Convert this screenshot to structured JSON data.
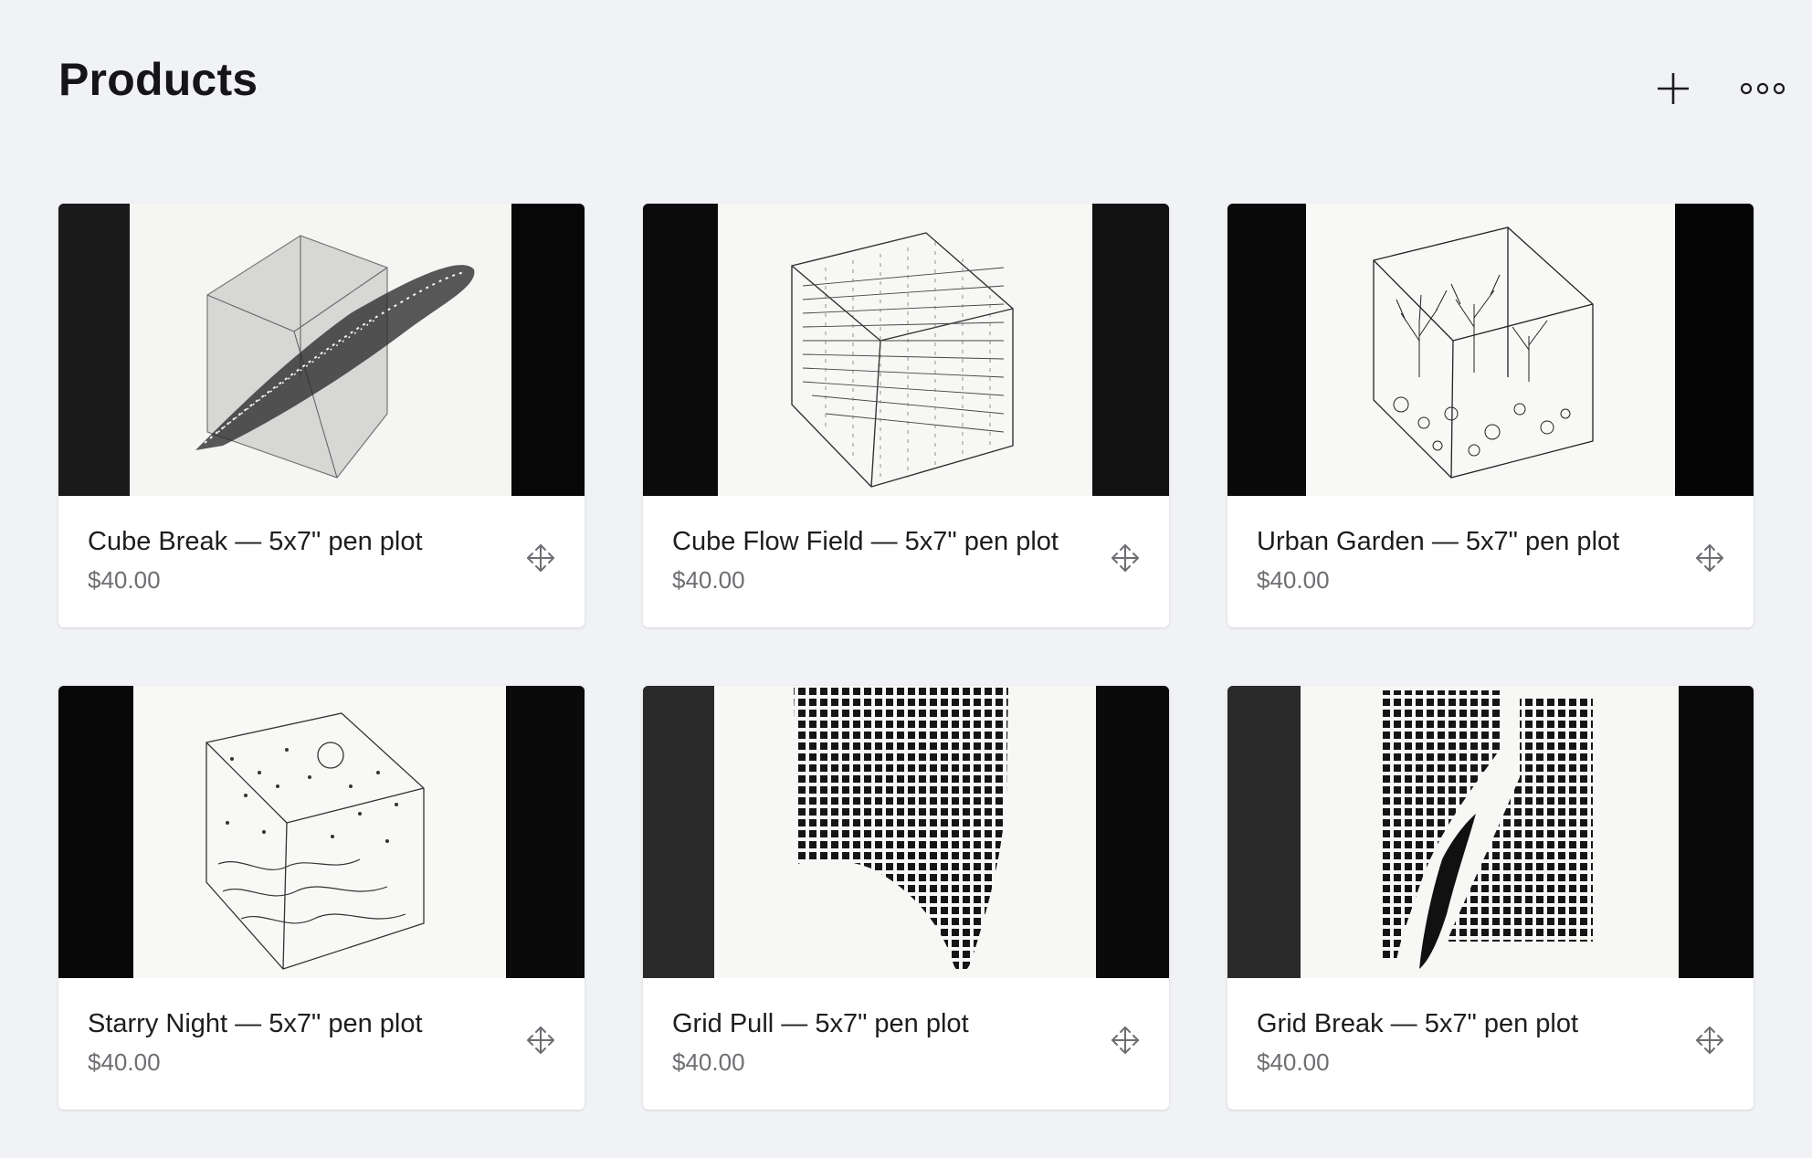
{
  "header": {
    "title": "Products",
    "add_icon": "plus-icon",
    "more_icon": "more-horizontal-icon"
  },
  "products": [
    {
      "title": "Cube Break — 5x7\" pen plot",
      "price": "$40.00",
      "image": "cube-break-artwork"
    },
    {
      "title": "Cube Flow Field — 5x7\" pen plot",
      "price": "$40.00",
      "image": "cube-flow-field-artwork"
    },
    {
      "title": "Urban Garden — 5x7\" pen plot",
      "price": "$40.00",
      "image": "urban-garden-artwork"
    },
    {
      "title": "Starry Night — 5x7\" pen plot",
      "price": "$40.00",
      "image": "starry-night-artwork"
    },
    {
      "title": "Grid Pull — 5x7\" pen plot",
      "price": "$40.00",
      "image": "grid-pull-artwork"
    },
    {
      "title": "Grid Break — 5x7\" pen plot",
      "price": "$40.00",
      "image": "grid-break-artwork"
    }
  ],
  "colors": {
    "background": "#f1f2f5",
    "card": "#ffffff",
    "text": "#1d1d1f",
    "muted": "#6e6e73"
  }
}
